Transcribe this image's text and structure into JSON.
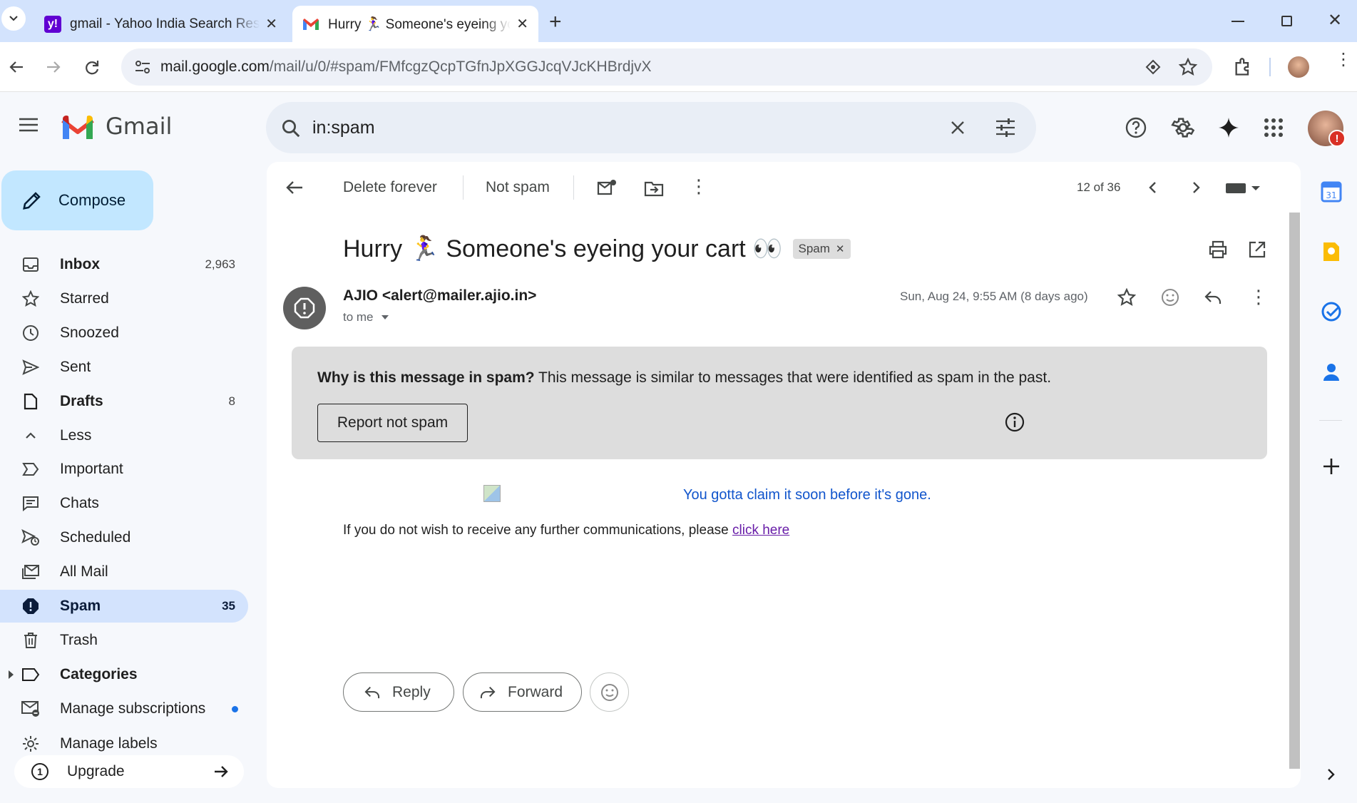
{
  "browser": {
    "tabs": [
      {
        "title": "gmail - Yahoo India Search Resu",
        "active": false
      },
      {
        "title": "Hurry 🏃‍♀️ Someone's eyeing your cart",
        "active": true
      }
    ],
    "new_tab": "+",
    "url_host": "mail.google.com",
    "url_path": "/mail/u/0/#spam/FMfcgzQcpTGfnJpXGGJcqVJcKHBrdjvX"
  },
  "gmail": {
    "logo_text": "Gmail",
    "search_value": "in:spam"
  },
  "sidebar": {
    "compose_label": "Compose",
    "items": [
      {
        "label": "Inbox",
        "count": "2,963",
        "icon": "inbox-icon"
      },
      {
        "label": "Starred",
        "count": "",
        "icon": "star-icon"
      },
      {
        "label": "Snoozed",
        "count": "",
        "icon": "clock-icon"
      },
      {
        "label": "Sent",
        "count": "",
        "icon": "send-icon"
      },
      {
        "label": "Drafts",
        "count": "8",
        "icon": "draft-icon"
      },
      {
        "label": "Less",
        "count": "",
        "icon": "chevron-up-icon"
      },
      {
        "label": "Important",
        "count": "",
        "icon": "important-icon"
      },
      {
        "label": "Chats",
        "count": "",
        "icon": "chat-icon"
      },
      {
        "label": "Scheduled",
        "count": "",
        "icon": "scheduled-icon"
      },
      {
        "label": "All Mail",
        "count": "",
        "icon": "all-mail-icon"
      },
      {
        "label": "Spam",
        "count": "35",
        "icon": "spam-icon"
      },
      {
        "label": "Trash",
        "count": "",
        "icon": "trash-icon"
      },
      {
        "label": "Categories",
        "count": "",
        "icon": "label-icon"
      },
      {
        "label": "Manage subscriptions",
        "count": "",
        "icon": "subscriptions-icon"
      },
      {
        "label": "Manage labels",
        "count": "",
        "icon": "gear-icon"
      }
    ],
    "upgrade_label": "Upgrade"
  },
  "message_toolbar": {
    "delete_forever": "Delete forever",
    "not_spam": "Not spam",
    "pagination": "12 of 36"
  },
  "message": {
    "subject": "Hurry 🏃‍♀️ Someone's eyeing your cart 👀",
    "spam_chip": "Spam",
    "sender": "AJIO <alert@mailer.ajio.in>",
    "to": "to me",
    "date": "Sun, Aug 24, 9:55 AM (8 days ago)",
    "spam_notice_bold": "Why is this message in spam?",
    "spam_notice_text": " This message is similar to messages that were identified as spam in the past.",
    "report_not_spam": "Report not spam",
    "claim_text": "You gotta claim it soon before it's gone.",
    "unsubscribe_text": "If you do not wish to receive any further communications, please ",
    "unsubscribe_link": "click here",
    "reply_label": "Reply",
    "forward_label": "Forward"
  },
  "colors": {
    "active_nav": "#d3e3fd",
    "compose_bg": "#c2e7ff",
    "link_blue": "#1155cc",
    "visited_link": "#681da8"
  }
}
